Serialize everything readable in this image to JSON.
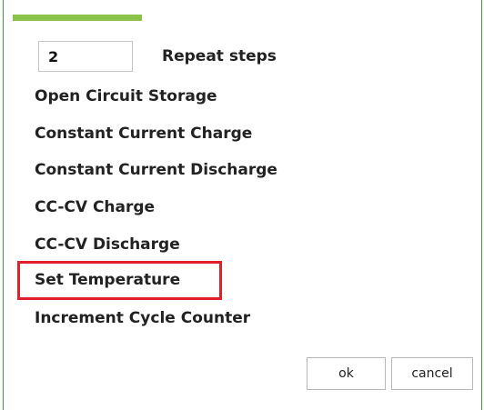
{
  "dialog": {
    "repeat": {
      "value": "2",
      "label": "Repeat steps"
    },
    "steps": [
      "Open Circuit Storage",
      "Constant Current Charge",
      "Constant Current Discharge",
      "CC-CV Charge",
      "CC-CV Discharge",
      "Set Temperature",
      "Increment Cycle Counter"
    ],
    "highlighted_step": "Set Temperature",
    "buttons": {
      "ok": "ok",
      "cancel": "cancel"
    },
    "colors": {
      "accent": "#8bc34a",
      "frame_border": "#3a9d3a",
      "highlight": "#e0202a"
    }
  }
}
